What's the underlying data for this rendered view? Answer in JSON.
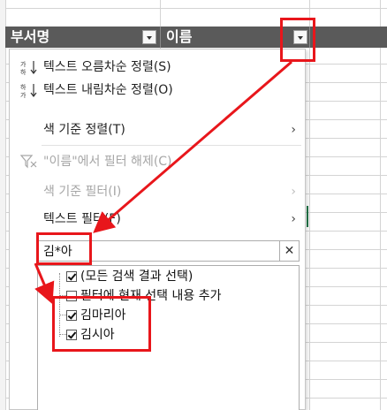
{
  "sheet": {
    "headers": [
      "부서명",
      "이름"
    ]
  },
  "menu": {
    "sort_asc": "텍스트 오름차순 정렬(S)",
    "sort_desc": "텍스트 내림차순 정렬(O)",
    "sort_color": "색 기준 정렬(T)",
    "clear_filter": "\"이름\"에서 필터 해제(C)",
    "filter_color": "색 기준 필터(I)",
    "text_filter": "텍스트 필터(F)"
  },
  "search": {
    "value": "김*아",
    "clear_symbol": "✕"
  },
  "list": {
    "items": [
      {
        "label": "(모든 검색 결과 선택)",
        "checked": true
      },
      {
        "label": "필터에 현재 선택 내용 추가",
        "checked": false
      },
      {
        "label": "김마리아",
        "checked": true
      },
      {
        "label": "김시아",
        "checked": true
      }
    ]
  },
  "colors": {
    "header_bg": "#5a5a5a",
    "annotation_red": "#e8161b",
    "excel_green": "#217346"
  },
  "icons": {
    "sort_asc": "sort-ascending-icon",
    "sort_desc": "sort-descending-icon",
    "clear_filter": "clear-filter-icon",
    "submenu": "chevron-right-icon",
    "dropdown": "filter-dropdown-icon"
  }
}
